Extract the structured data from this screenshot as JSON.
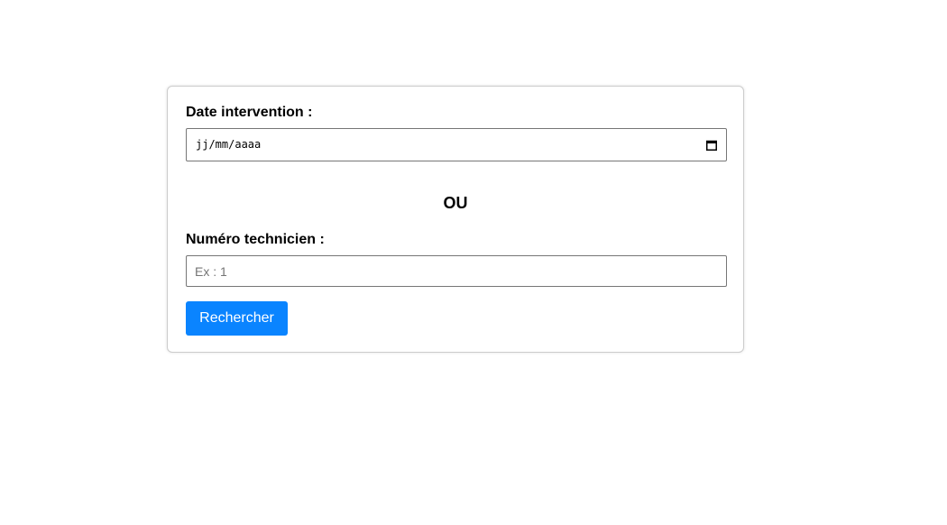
{
  "form": {
    "date_label": "Date intervention :",
    "date_placeholder": "jj/mm/aaaa",
    "date_icon": "calendar-icon",
    "separator": "OU",
    "tech_label": "Numéro technicien :",
    "tech_placeholder": "Ex : 1",
    "tech_value": "",
    "submit_label": "Rechercher"
  },
  "colors": {
    "accent": "#0a84ff",
    "border": "#767676",
    "card_border": "#cccccc",
    "background": "#ffffff"
  }
}
